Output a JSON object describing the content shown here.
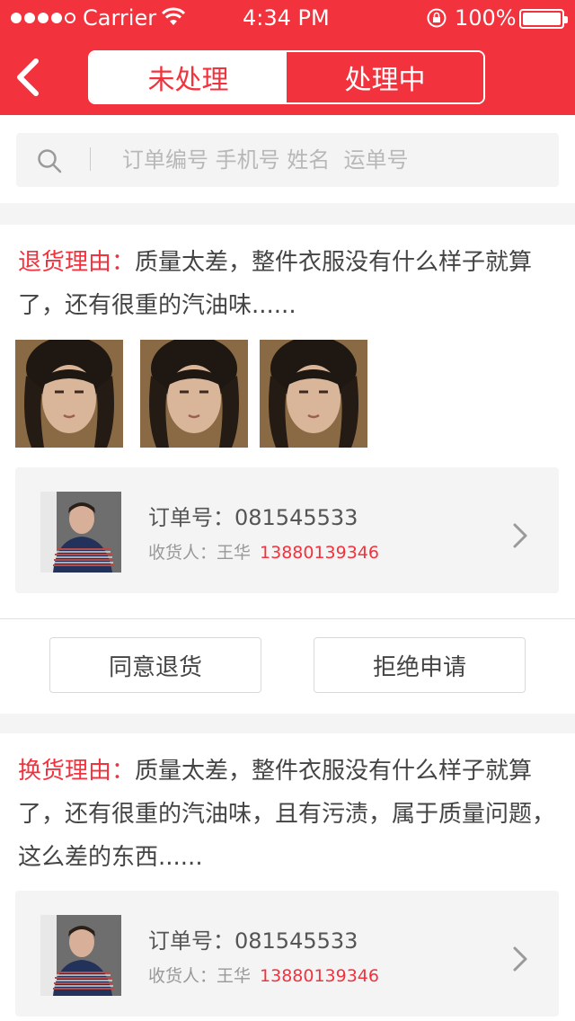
{
  "status_bar": {
    "carrier": "Carrier",
    "time": "4:34 PM",
    "battery": "100%",
    "battery_level": 1.0
  },
  "header": {
    "tabs": [
      {
        "label": "未处理",
        "active": true
      },
      {
        "label": "处理中",
        "active": false
      }
    ]
  },
  "search": {
    "placeholder": "订单编号 手机号 姓名  运单号"
  },
  "colors": {
    "accent": "#f2323c",
    "background": "#f4f4f4"
  },
  "cards": [
    {
      "reason_label": "退货理由：",
      "reason_text": "质量太差，整件衣服没有什么样子就算了，还有很重的汽油味......",
      "photos": [
        "photo",
        "photo",
        "photo"
      ],
      "order_no": "订单号：081545533",
      "receiver_label": "收货人：王华",
      "receiver_phone": "13880139346",
      "actions": {
        "agree": "同意退货",
        "reject": "拒绝申请"
      }
    },
    {
      "reason_label": "换货理由：",
      "reason_text": "质量太差，整件衣服没有什么样子就算了，还有很重的汽油味，且有污渍，属于质量问题，这么差的东西......",
      "order_no": "订单号：081545533",
      "receiver_label": "收货人：王华",
      "receiver_phone": "13880139346"
    }
  ]
}
